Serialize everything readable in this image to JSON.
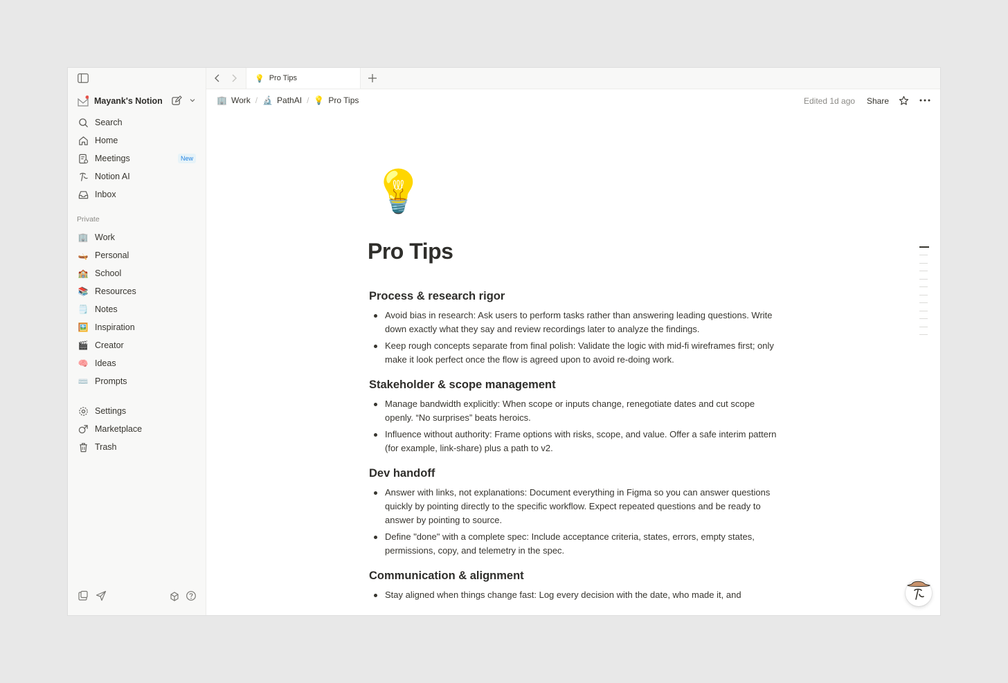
{
  "sidebar": {
    "workspace_name": "Mayank's Notion",
    "top_items": [
      {
        "label": "Search",
        "icon": "search-icon"
      },
      {
        "label": "Home",
        "icon": "home-icon"
      },
      {
        "label": "Meetings",
        "icon": "meetings-icon",
        "badge": "New"
      },
      {
        "label": "Notion AI",
        "icon": "notion-ai-icon"
      },
      {
        "label": "Inbox",
        "icon": "inbox-icon"
      }
    ],
    "section_label": "Private",
    "pages": [
      {
        "label": "Work",
        "emoji": "🏢"
      },
      {
        "label": "Personal",
        "emoji": "🛶"
      },
      {
        "label": "School",
        "emoji": "🏫"
      },
      {
        "label": "Resources",
        "emoji": "📚"
      },
      {
        "label": "Notes",
        "emoji": "🗒️"
      },
      {
        "label": "Inspiration",
        "emoji": "🖼️"
      },
      {
        "label": "Creator",
        "emoji": "🎬"
      },
      {
        "label": "Ideas",
        "emoji": "🧠"
      },
      {
        "label": "Prompts",
        "emoji": "⌨️"
      }
    ],
    "bottom_items": [
      {
        "label": "Settings",
        "icon": "settings-icon"
      },
      {
        "label": "Marketplace",
        "icon": "marketplace-icon"
      },
      {
        "label": "Trash",
        "icon": "trash-icon"
      }
    ]
  },
  "tab": {
    "label": "Pro Tips",
    "emoji": "💡"
  },
  "breadcrumb": [
    {
      "label": "Work",
      "emoji": "🏢"
    },
    {
      "label": "PathAI",
      "emoji": "🔬"
    },
    {
      "label": "Pro Tips",
      "emoji": "💡"
    }
  ],
  "header": {
    "edited": "Edited 1d ago",
    "share": "Share"
  },
  "page": {
    "emoji": "💡",
    "title": "Pro Tips",
    "sections": [
      {
        "heading": "Process & research rigor",
        "bullets": [
          "Avoid bias in research: Ask users to perform tasks rather than answering leading questions. Write down exactly what they say and review recordings later to analyze the findings.",
          "Keep rough concepts separate from final polish: Validate the logic with mid-fi wireframes first; only make it look perfect once the flow is agreed upon to avoid re-doing work."
        ]
      },
      {
        "heading": "Stakeholder & scope management",
        "bullets": [
          "Manage bandwidth explicitly: When scope or inputs change, renegotiate dates and cut scope openly. “No surprises” beats heroics.",
          "Influence without authority: Frame options with risks, scope, and value. Offer a safe interim pattern (for example, link-share) plus a path to v2."
        ]
      },
      {
        "heading": "Dev handoff",
        "bullets": [
          "Answer with links, not explanations: Document everything in Figma so you can answer questions quickly by pointing directly to the specific workflow. Expect repeated questions and be ready to answer by pointing to source.",
          "Define \"done\" with a complete spec: Include acceptance criteria, states, errors, empty states, permissions, copy, and telemetry in the spec."
        ]
      },
      {
        "heading": "Communication & alignment",
        "bullets": [
          "Stay aligned when things change fast: Log every decision with the date, who made it, and"
        ]
      }
    ]
  }
}
